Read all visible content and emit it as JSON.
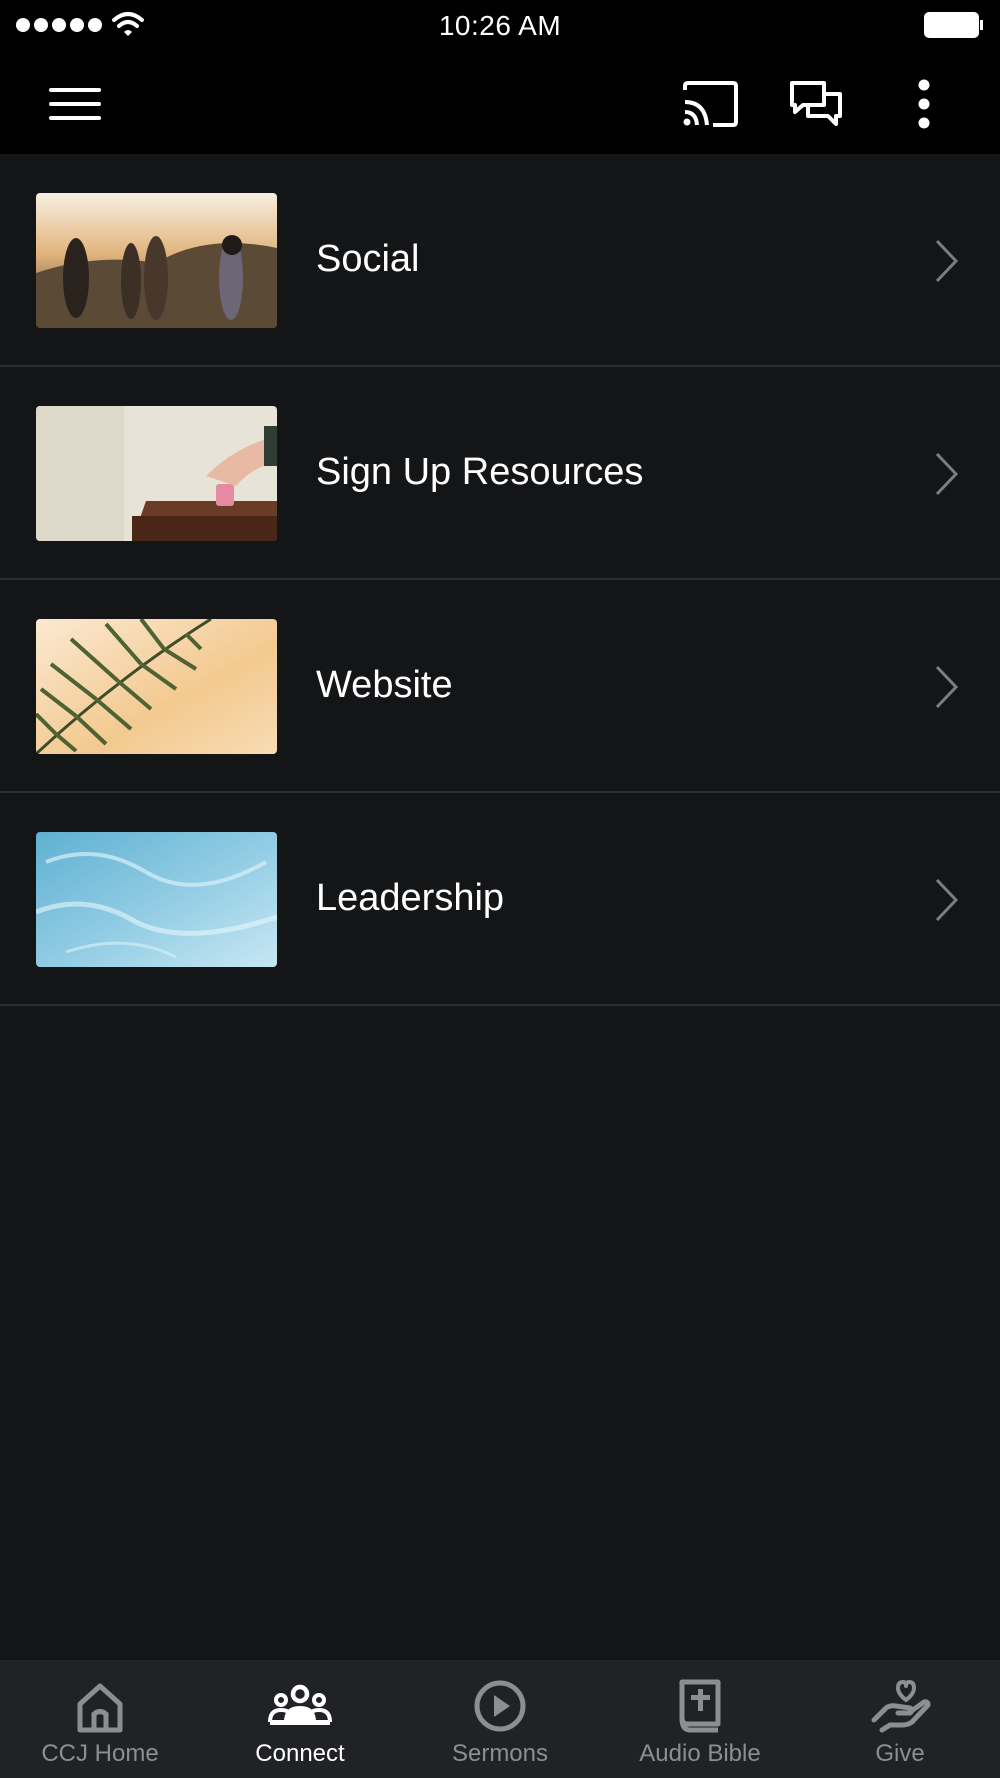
{
  "status_bar": {
    "time": "10:26 AM"
  },
  "toolbar": {
    "menu_icon": "hamburger-menu-icon",
    "cast_icon": "cast-icon",
    "chat_icon": "chat-bubbles-icon",
    "more_icon": "more-vertical-icon"
  },
  "list": {
    "items": [
      {
        "label": "Social"
      },
      {
        "label": "Sign Up Resources"
      },
      {
        "label": "Website"
      },
      {
        "label": "Leadership"
      }
    ]
  },
  "tabbar": {
    "active_color": "#ffffff",
    "inactive_color": "#8d8e92",
    "tabs": [
      {
        "label": "CCJ Home",
        "icon": "home-icon"
      },
      {
        "label": "Connect",
        "icon": "people-icon",
        "active": true
      },
      {
        "label": "Sermons",
        "icon": "play-circle-icon"
      },
      {
        "label": "Audio Bible",
        "icon": "bible-icon"
      },
      {
        "label": "Give",
        "icon": "heart-hand-icon"
      }
    ]
  }
}
